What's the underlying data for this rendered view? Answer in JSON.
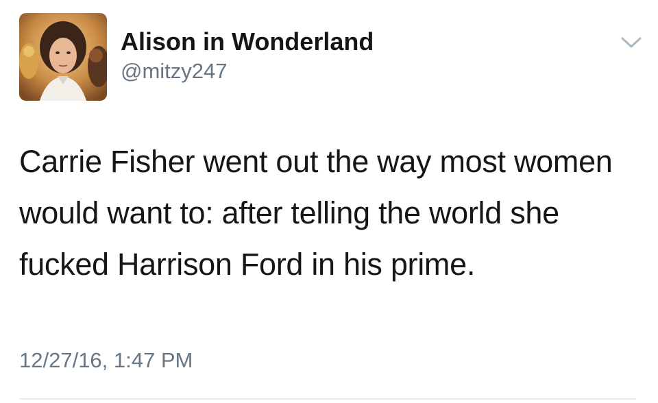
{
  "tweet": {
    "author": {
      "display_name": "Alison in Wonderland",
      "handle": "@mitzy247",
      "avatar_icon": "avatar-illustration"
    },
    "text": "Carrie Fisher went out the way most women would want to: after telling the world she fucked Harrison Ford in his prime.",
    "timestamp": "12/27/16, 1:47 PM",
    "menu_icon": "chevron-down-icon"
  },
  "colors": {
    "text_primary": "#14171a",
    "text_secondary": "#657786",
    "caret": "#aab8c2",
    "divider": "#e6ecf0"
  }
}
